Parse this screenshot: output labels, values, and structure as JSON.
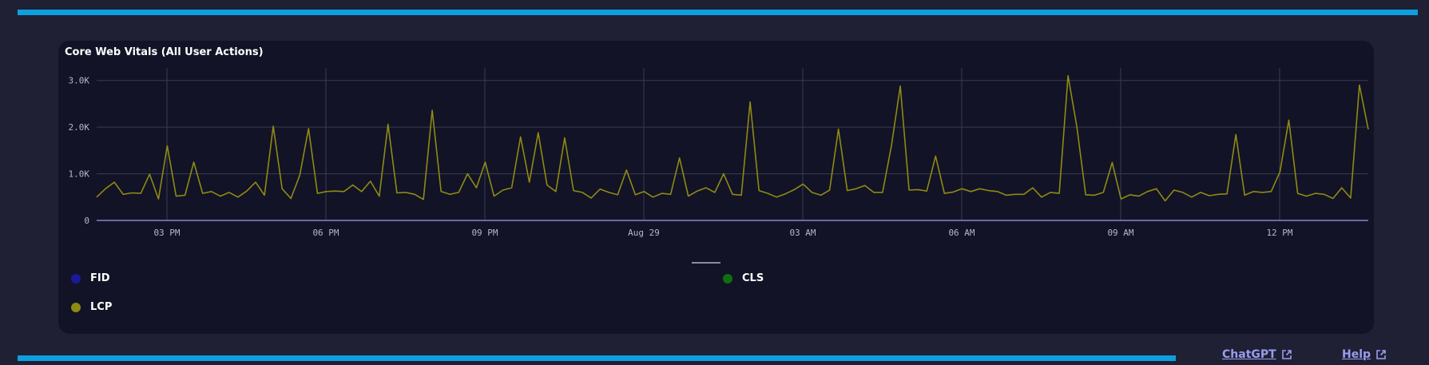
{
  "panel": {
    "title": "Core Web Vitals (All User Actions)"
  },
  "chart_data": {
    "type": "line",
    "title": "Core Web Vitals (All User Actions)",
    "xlabel": "",
    "ylabel": "",
    "y_ticks": [
      "0",
      "1.0K",
      "2.0K",
      "3.0K"
    ],
    "x_ticks": [
      "03 PM",
      "06 PM",
      "09 PM",
      "Aug 29",
      "03 AM",
      "06 AM",
      "09 AM",
      "12 PM"
    ],
    "ylim": [
      0,
      3200
    ],
    "grid": true,
    "legend_position": "bottom",
    "series": [
      {
        "name": "LCP",
        "color": "#8f8a13",
        "values": [
          500,
          680,
          820,
          560,
          590,
          580,
          990,
          460,
          1600,
          520,
          540,
          1250,
          580,
          620,
          520,
          600,
          500,
          630,
          820,
          540,
          2020,
          680,
          470,
          970,
          1970,
          580,
          620,
          630,
          620,
          760,
          620,
          840,
          520,
          2060,
          590,
          600,
          560,
          450,
          2360,
          620,
          560,
          600,
          1000,
          700,
          1250,
          520,
          650,
          700,
          1790,
          820,
          1880,
          760,
          620,
          1770,
          640,
          600,
          480,
          670,
          600,
          550,
          1080,
          550,
          620,
          500,
          580,
          560,
          1340,
          520,
          630,
          700,
          600,
          1000,
          560,
          540,
          2540,
          640,
          580,
          500,
          570,
          660,
          780,
          600,
          540,
          650,
          1960,
          640,
          680,
          750,
          600,
          600,
          1600,
          2880,
          650,
          660,
          630,
          1380,
          580,
          610,
          680,
          620,
          680,
          640,
          620,
          540,
          560,
          560,
          700,
          500,
          600,
          580,
          3100,
          2000,
          550,
          540,
          600,
          1240,
          460,
          550,
          520,
          620,
          680,
          420,
          650,
          600,
          500,
          600,
          530,
          560,
          570,
          1840,
          540,
          620,
          600,
          620,
          1040,
          2150,
          580,
          520,
          580,
          560,
          470,
          700,
          480,
          2900,
          1950
        ]
      },
      {
        "name": "FID",
        "color": "#1a1a9a",
        "values": []
      },
      {
        "name": "CLS",
        "color": "#0f6e10",
        "values": []
      }
    ]
  },
  "legend": {
    "items": [
      {
        "name": "FID",
        "color": "#1a1a9a"
      },
      {
        "name": "CLS",
        "color": "#0f6e10"
      },
      {
        "name": "LCP",
        "color": "#8f8a13"
      }
    ]
  },
  "footer": {
    "chatgpt_label": "ChatGPT",
    "help_label": "Help"
  },
  "colors": {
    "accent_bar": "#0e9fe0",
    "background": "#1f2033",
    "panel": "#121326",
    "link": "#9a9cf0"
  },
  "icons": {
    "external_link": "external-link-icon"
  }
}
